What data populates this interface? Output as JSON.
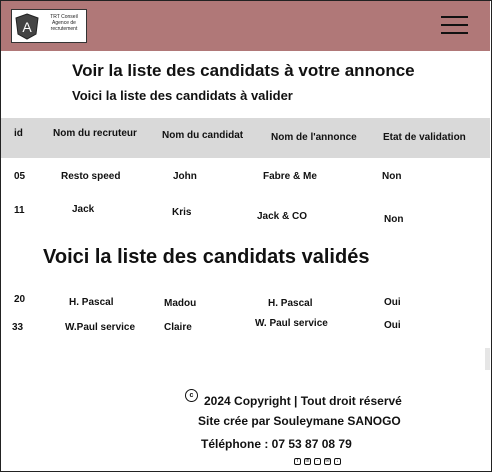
{
  "navbar": {
    "logo_letter": "A",
    "logo_lines": [
      "TRT Conseil",
      "Agence de",
      "recrutement"
    ],
    "menu_icon": "hamburger-icon"
  },
  "main": {
    "title": "Voir la liste des candidats à votre annonce",
    "subtitle": "Voici la liste des candidats à valider",
    "columns": [
      "id",
      "Nom du recruteur",
      "Nom du candidat",
      "Nom de l'annonce",
      "Etat de validation"
    ],
    "pending": [
      {
        "id": "05",
        "recruteur": "Resto speed",
        "candidat": "John",
        "annonce": "Fabre & Me",
        "etat": "Non"
      },
      {
        "id": "11",
        "recruteur": "Jack",
        "candidat": "Kris",
        "annonce": "Jack & CO",
        "etat": "Non"
      }
    ],
    "validated_title": "Voici la liste des candidats validés",
    "validated": [
      {
        "id": "20",
        "recruteur": "H. Pascal",
        "candidat": "Madou",
        "annonce": "H. Pascal",
        "etat": "Oui"
      },
      {
        "id": "33",
        "recruteur": "W.Paul service",
        "candidat": "Claire",
        "annonce": "W. Paul service",
        "etat": "Oui"
      }
    ]
  },
  "footer": {
    "copyright_symbol": "c",
    "copyright": "2024 Copyright | Tout droit réservé",
    "credit": "Site crée par Souleymane SANOGO",
    "phone": "Téléphone : 07 53 87 08 79",
    "social_icons": [
      "facebook-icon",
      "linkedin-icon",
      "instagram-icon",
      "email-icon",
      "download-icon"
    ]
  }
}
